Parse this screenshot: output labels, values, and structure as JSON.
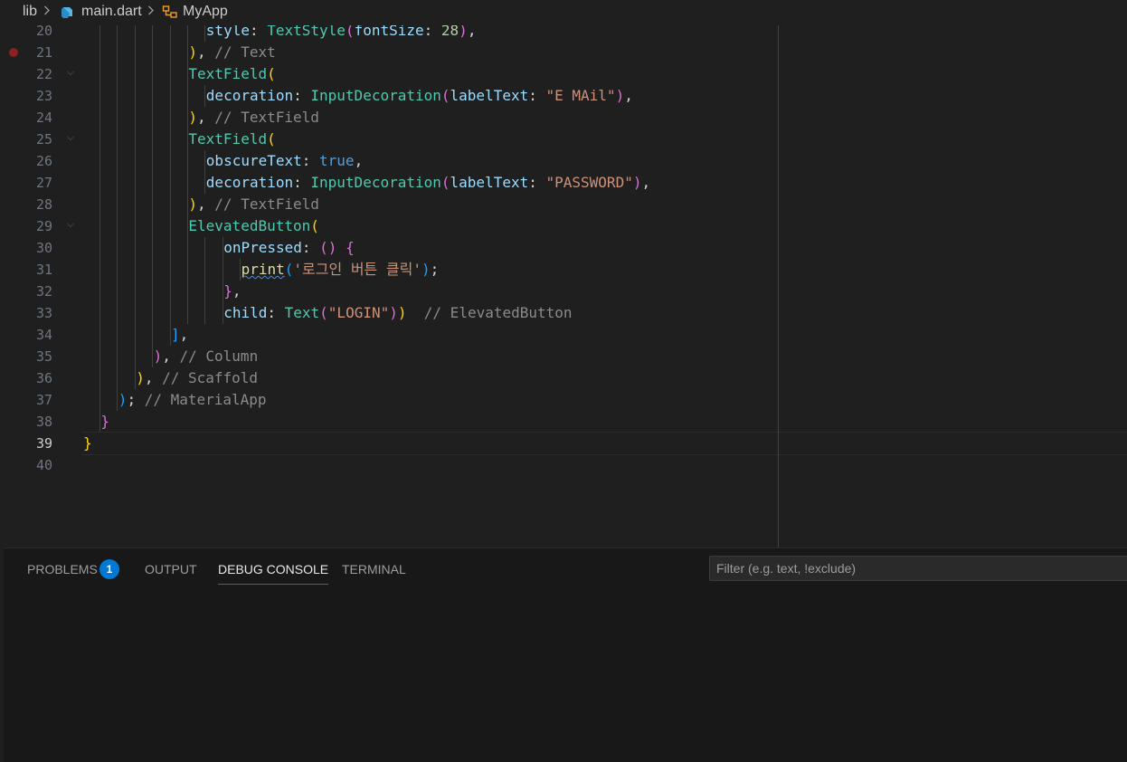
{
  "breadcrumb": {
    "items": [
      "lib",
      "main.dart",
      "MyApp"
    ],
    "icons": [
      "chevron-right-icon",
      "dart-file-icon",
      "class-symbol-icon"
    ]
  },
  "editor": {
    "active_line": "39",
    "breakpoint_line": "21",
    "lines": [
      {
        "n": "20",
        "tokens": [
          [
            "style",
            "c-prop"
          ],
          [
            ": ",
            ""
          ],
          [
            "TextStyle",
            "c-cls"
          ],
          [
            "(",
            "c-b2"
          ],
          [
            "fontSize",
            "c-prop"
          ],
          [
            ": ",
            ""
          ],
          [
            "28",
            "c-num"
          ],
          [
            ")",
            "c-b2"
          ],
          [
            ",",
            ""
          ]
        ]
      },
      {
        "n": "21",
        "tokens": [
          [
            ")",
            "c-b1"
          ],
          [
            ", ",
            ""
          ],
          [
            "// Text",
            "c-com"
          ]
        ]
      },
      {
        "n": "22",
        "tokens": [
          [
            "TextField",
            "c-cls"
          ],
          [
            "(",
            "c-b1"
          ]
        ]
      },
      {
        "n": "23",
        "tokens": [
          [
            "decoration",
            "c-prop"
          ],
          [
            ": ",
            ""
          ],
          [
            "InputDecoration",
            "c-cls"
          ],
          [
            "(",
            "c-b2"
          ],
          [
            "labelText",
            "c-prop"
          ],
          [
            ": ",
            ""
          ],
          [
            "\"E MAil\"",
            "c-str"
          ],
          [
            ")",
            "c-b2"
          ],
          [
            ",",
            ""
          ]
        ]
      },
      {
        "n": "24",
        "tokens": [
          [
            ")",
            "c-b1"
          ],
          [
            ", ",
            ""
          ],
          [
            "// TextField",
            "c-com"
          ]
        ]
      },
      {
        "n": "25",
        "tokens": [
          [
            "TextField",
            "c-cls"
          ],
          [
            "(",
            "c-b1"
          ]
        ]
      },
      {
        "n": "26",
        "tokens": [
          [
            "obscureText",
            "c-prop"
          ],
          [
            ": ",
            ""
          ],
          [
            "true",
            "c-kw"
          ],
          [
            ",",
            ""
          ]
        ]
      },
      {
        "n": "27",
        "tokens": [
          [
            "decoration",
            "c-prop"
          ],
          [
            ": ",
            ""
          ],
          [
            "InputDecoration",
            "c-cls"
          ],
          [
            "(",
            "c-b2"
          ],
          [
            "labelText",
            "c-prop"
          ],
          [
            ": ",
            ""
          ],
          [
            "\"PASSWORD\"",
            "c-str"
          ],
          [
            ")",
            "c-b2"
          ],
          [
            ",",
            ""
          ]
        ]
      },
      {
        "n": "28",
        "tokens": [
          [
            ")",
            "c-b1"
          ],
          [
            ", ",
            ""
          ],
          [
            "// TextField",
            "c-com"
          ]
        ]
      },
      {
        "n": "29",
        "tokens": [
          [
            "ElevatedButton",
            "c-cls"
          ],
          [
            "(",
            "c-b1"
          ]
        ]
      },
      {
        "n": "30",
        "tokens": [
          [
            "onPressed",
            "c-prop"
          ],
          [
            ": ",
            ""
          ],
          [
            "()",
            "c-b2"
          ],
          [
            " ",
            ""
          ],
          [
            "{",
            "c-b2"
          ]
        ]
      },
      {
        "n": "31",
        "tokens": [
          [
            "print",
            "c-fn squiggle"
          ],
          [
            "(",
            "c-b3"
          ],
          [
            "'로그인 버튼 클릭'",
            "c-str"
          ],
          [
            ")",
            "c-b3"
          ],
          [
            ";",
            ""
          ]
        ]
      },
      {
        "n": "32",
        "tokens": [
          [
            "}",
            "c-b2"
          ],
          [
            ",",
            ""
          ]
        ]
      },
      {
        "n": "33",
        "tokens": [
          [
            "child",
            "c-prop"
          ],
          [
            ": ",
            ""
          ],
          [
            "Text",
            "c-cls"
          ],
          [
            "(",
            "c-b2"
          ],
          [
            "\"LOGIN\"",
            "c-str"
          ],
          [
            ")",
            "c-b2"
          ],
          [
            ")",
            "c-b1"
          ],
          [
            "  ",
            ""
          ],
          [
            "// ElevatedButton",
            "c-com"
          ]
        ]
      },
      {
        "n": "34",
        "tokens": [
          [
            "]",
            "c-b3"
          ],
          [
            ",",
            ""
          ]
        ]
      },
      {
        "n": "35",
        "tokens": [
          [
            ")",
            "c-b2"
          ],
          [
            ", ",
            ""
          ],
          [
            "// Column",
            "c-com"
          ]
        ]
      },
      {
        "n": "36",
        "tokens": [
          [
            ")",
            "c-b1"
          ],
          [
            ", ",
            ""
          ],
          [
            "// Scaffold",
            "c-com"
          ]
        ]
      },
      {
        "n": "37",
        "tokens": [
          [
            ")",
            "c-b3"
          ],
          [
            "; ",
            ""
          ],
          [
            "// MaterialApp",
            "c-com"
          ]
        ]
      },
      {
        "n": "38",
        "tokens": [
          [
            "}",
            "c-b2"
          ]
        ]
      },
      {
        "n": "39",
        "tokens": [
          [
            "}",
            "c-b1"
          ]
        ]
      },
      {
        "n": "40",
        "tokens": []
      }
    ]
  },
  "panel": {
    "tabs": [
      {
        "label": "PROBLEMS",
        "name": "tab-problems",
        "active": false
      },
      {
        "label": "OUTPUT",
        "name": "tab-output",
        "active": false
      },
      {
        "label": "DEBUG CONSOLE",
        "name": "tab-debug-console",
        "active": true
      },
      {
        "label": "TERMINAL",
        "name": "tab-terminal",
        "active": false
      }
    ],
    "problems_count": "1",
    "filter_placeholder": "Filter (e.g. text, !exclude)"
  },
  "colors": {
    "background": "#1f1f1f",
    "panel_background": "#181818",
    "accent": "#0078d4",
    "breakpoint": "#8b2121"
  }
}
